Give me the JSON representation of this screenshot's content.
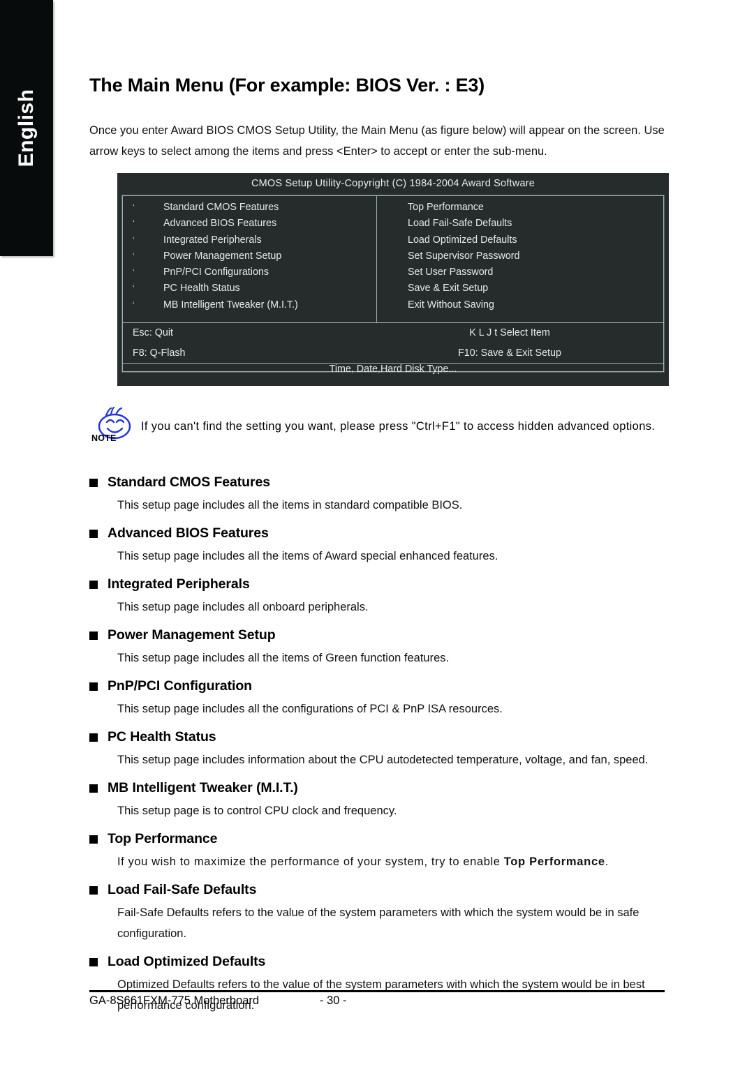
{
  "sidebar": {
    "language_tab": "English"
  },
  "page": {
    "title": "The Main Menu (For example: BIOS Ver. : E3)",
    "intro": "Once you enter Award BIOS CMOS Setup Utility, the Main Menu (as figure below) will appear on the screen. Use arrow keys to select among the items and press <Enter> to accept or enter the sub-menu."
  },
  "bios": {
    "titlebar": "CMOS Setup Utility-Copyright (C) 1984-2004 Award Software",
    "bullet_glyph": "‘",
    "left_items": [
      "Standard CMOS Features",
      "Advanced BIOS Features",
      "Integrated Peripherals",
      "Power Management Setup",
      "PnP/PCI Configurations",
      "PC Health Status",
      "MB Intelligent Tweaker (M.I.T.)"
    ],
    "right_items": [
      "Top Performance",
      "Load Fail-Safe Defaults",
      "Load Optimized Defaults",
      "Set Supervisor Password",
      "Set User Password",
      "Save & Exit Setup",
      "Exit Without Saving"
    ],
    "key_rows": [
      {
        "left": "Esc: Quit",
        "right": "K L J t Select Item"
      },
      {
        "left": "F8: Q-Flash",
        "right": "F10: Save & Exit Setup"
      }
    ],
    "hint": "Time, Date,Hard Disk Type..."
  },
  "note": {
    "icon_label": "NOTE",
    "text": "If you can't find the setting you want, please press \"Ctrl+F1\" to access hidden advanced options."
  },
  "sections": [
    {
      "title": "Standard CMOS Features",
      "body": "This setup page includes all the items in standard compatible BIOS."
    },
    {
      "title": "Advanced BIOS Features",
      "body": "This setup page includes all the items of Award special enhanced features."
    },
    {
      "title": "Integrated Peripherals",
      "body": "This setup page includes all onboard peripherals."
    },
    {
      "title": "Power Management Setup",
      "body": "This setup page includes all the items of Green function features."
    },
    {
      "title": "PnP/PCI Configuration",
      "body": "This setup page includes all the configurations of PCI & PnP ISA resources."
    },
    {
      "title": "PC Health Status",
      "body": "This setup page includes information about the CPU autodetected temperature, voltage, and fan, speed."
    },
    {
      "title": "MB Intelligent Tweaker (M.I.T.)",
      "body": "This setup page is to control CPU clock and frequency."
    },
    {
      "title": "Top Performance",
      "body_pre": "If you wish to maximize the performance of your system, try to enable ",
      "body_bold": "Top Performance",
      "body_post": "."
    },
    {
      "title": "Load Fail-Safe Defaults",
      "body": "Fail-Safe Defaults refers to the value of the system parameters with which the system would be in safe configuration."
    },
    {
      "title": "Load Optimized Defaults",
      "body": "Optimized Defaults refers to the value of the system parameters with which the system would be in best performance configuration."
    }
  ],
  "footer": {
    "product": "GA-8S661FXM-775 Motherboard",
    "page_number": "- 30 -"
  }
}
